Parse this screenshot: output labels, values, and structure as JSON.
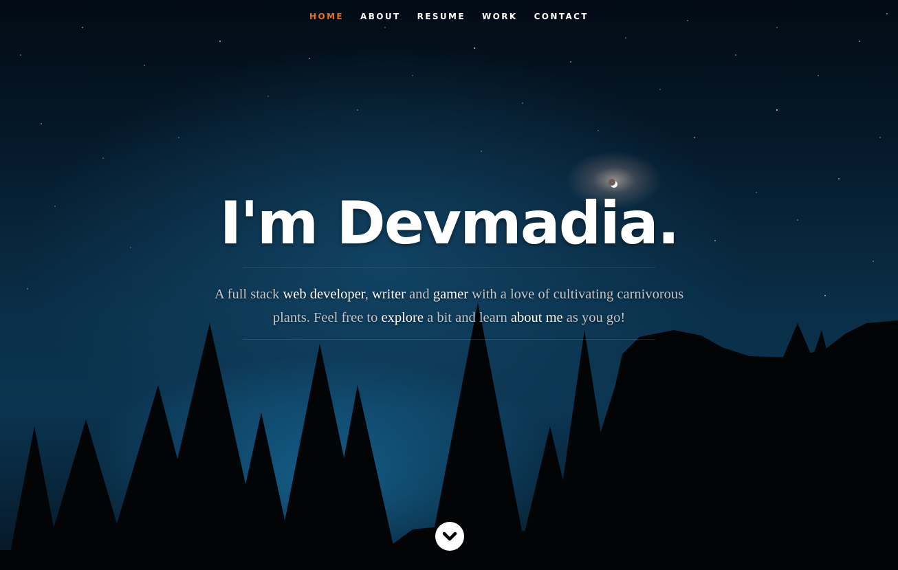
{
  "nav": {
    "items": [
      {
        "label": "HOME",
        "active": true
      },
      {
        "label": "ABOUT",
        "active": false
      },
      {
        "label": "RESUME",
        "active": false
      },
      {
        "label": "WORK",
        "active": false
      },
      {
        "label": "CONTACT",
        "active": false
      }
    ],
    "active_color": "#e96f19"
  },
  "banner": {
    "headline": "I'm Devmadia.",
    "intro": {
      "part1": "A full stack ",
      "hl_web": "web developer",
      "part2": ", ",
      "hl_writer": "writer",
      "part3": " and ",
      "hl_gamer": "gamer",
      "part4": " with a love of cultivating carnivorous plants. Feel free to ",
      "hl_explore": "explore",
      "part5": " a bit and learn ",
      "hl_about": "about me",
      "part6": " as you go!"
    }
  },
  "scroll": {
    "icon": "chevron-down-icon"
  }
}
